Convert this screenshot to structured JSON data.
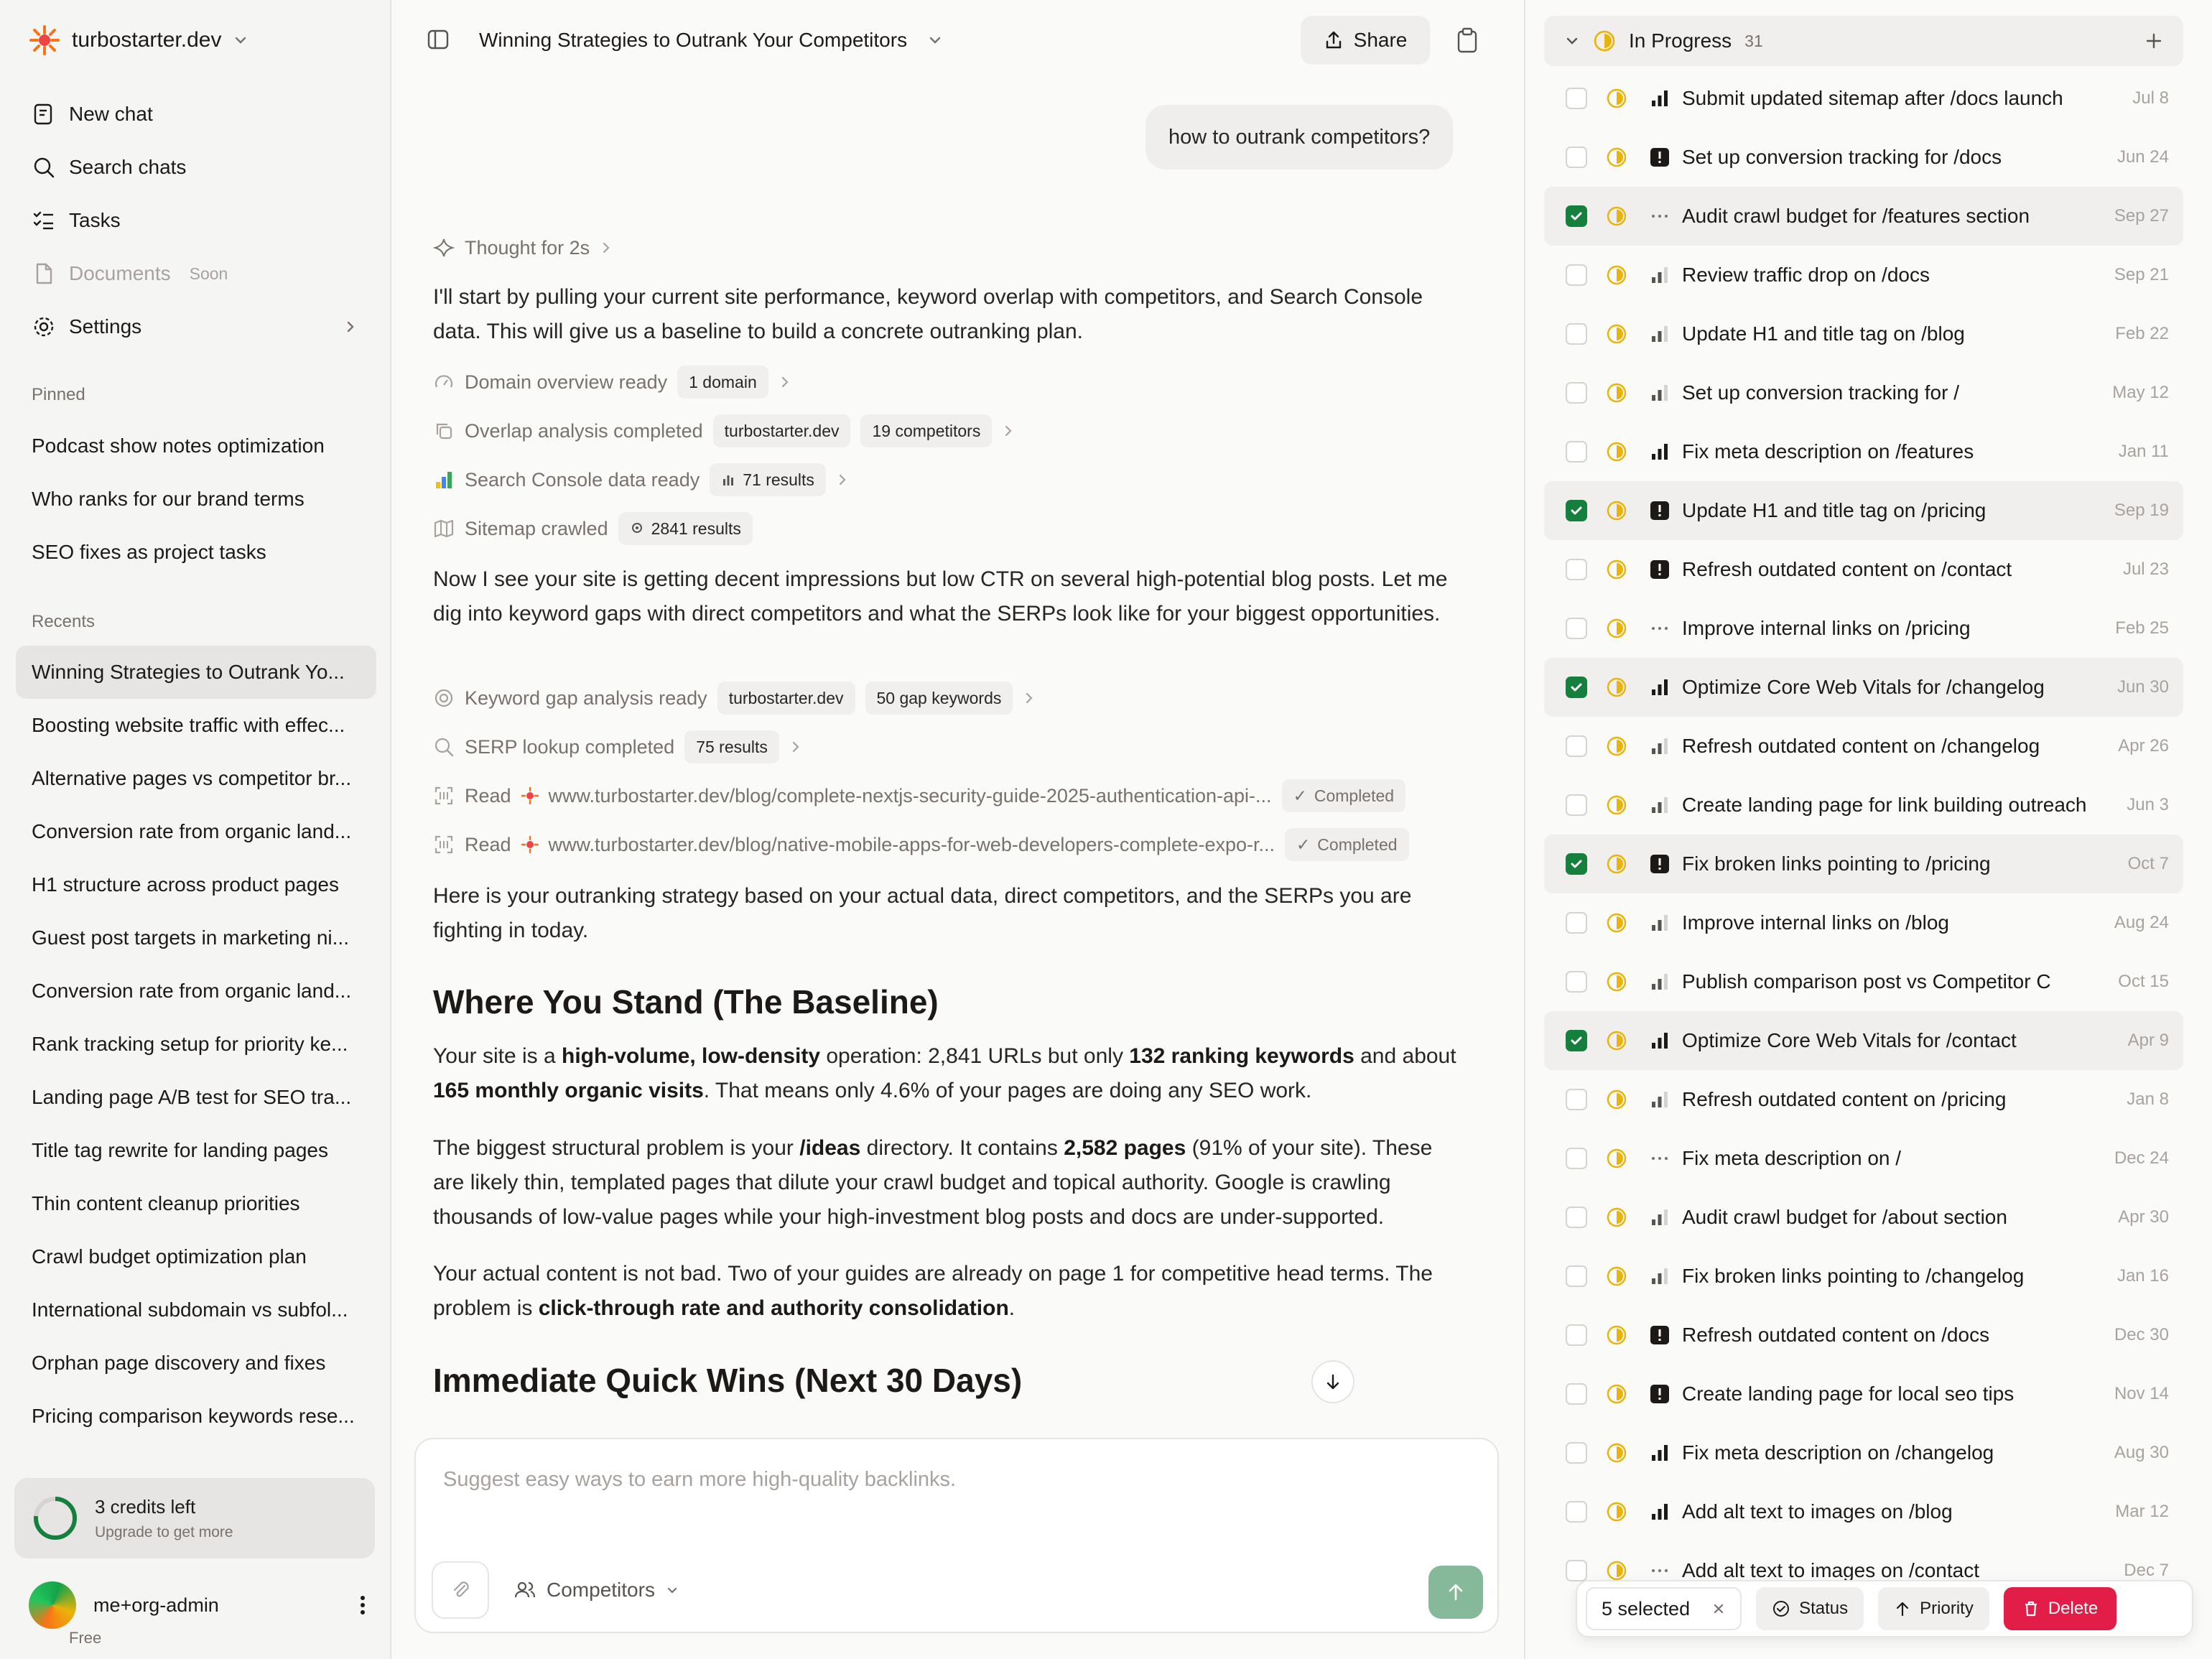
{
  "sidebar": {
    "brand": "turbostarter.dev",
    "nav": [
      {
        "label": "New chat"
      },
      {
        "label": "Search chats"
      },
      {
        "label": "Tasks"
      },
      {
        "label": "Documents",
        "badge": "Soon"
      },
      {
        "label": "Settings"
      }
    ],
    "pinned_title": "Pinned",
    "pinned": [
      "Podcast show notes optimization",
      "Who ranks for our brand terms",
      "SEO fixes as project tasks"
    ],
    "recents_title": "Recents",
    "recents": [
      "Winning Strategies to Outrank Yo...",
      "Boosting website traffic with effec...",
      "Alternative pages vs competitor br...",
      "Conversion rate from organic land...",
      "H1 structure across product pages",
      "Guest post targets in marketing ni...",
      "Conversion rate from organic land...",
      "Rank tracking setup for priority ke...",
      "Landing page A/B test for SEO tra...",
      "Title tag rewrite for landing pages",
      "Thin content cleanup priorities",
      "Crawl budget optimization plan",
      "International subdomain vs subfol...",
      "Orphan page discovery and fixes",
      "Pricing comparison keywords rese..."
    ],
    "credits": {
      "title": "3 credits left",
      "subtitle": "Upgrade to get more"
    },
    "user": {
      "name": "me+org-admin",
      "plan": "Free"
    }
  },
  "chat": {
    "title": "Winning Strategies to Outrank Your Competitors",
    "share_label": "Share",
    "user_message": "how to outrank competitors?",
    "thought": "Thought for 2s",
    "intro": "I'll start by pulling your current site performance, keyword overlap with competitors, and Search Console data. This will give us a baseline to build a concrete outranking plan.",
    "tools1": [
      {
        "label": "Domain overview ready",
        "chips": [
          "1 domain"
        ]
      },
      {
        "label": "Overlap analysis completed",
        "chips": [
          "turbostarter.dev",
          "19 competitors"
        ]
      },
      {
        "label": "Search Console data ready",
        "chips": [
          "71 results"
        ]
      },
      {
        "label": "Sitemap crawled",
        "chips": [
          "2841 results"
        ]
      }
    ],
    "para2": "Now I see your site is getting decent impressions but low CTR on several high-potential blog posts. Let me dig into keyword gaps with direct competitors and what the SERPs look like for your biggest opportunities.",
    "tools2": [
      {
        "label": "Keyword gap analysis ready",
        "chips": [
          "turbostarter.dev",
          "50 gap keywords"
        ]
      },
      {
        "label": "SERP lookup completed",
        "chips": [
          "75 results"
        ]
      }
    ],
    "reads": [
      {
        "verb": "Read",
        "url": "www.turbostarter.dev/blog/complete-nextjs-security-guide-2025-authentication-api-...",
        "status": "Completed"
      },
      {
        "verb": "Read",
        "url": "www.turbostarter.dev/blog/native-mobile-apps-for-web-developers-complete-expo-r...",
        "status": "Completed"
      }
    ],
    "para3": "Here is your outranking strategy based on your actual data, direct competitors, and the SERPs you are fighting in today.",
    "h_baseline": "Where You Stand (The Baseline)",
    "b1": {
      "t1": "Your site is a ",
      "b1": "high-volume, low-density",
      "t2": " operation: 2,841 URLs but only ",
      "b2": "132 ranking keywords",
      "t3": " and about ",
      "b3": "165 monthly organic visits",
      "t4": ". That means only 4.6% of your pages are doing any SEO work."
    },
    "b2": {
      "t1": "The biggest structural problem is your ",
      "b1": "/ideas",
      "t2": " directory. It contains ",
      "b2": "2,582 pages",
      "t3": " (91% of your site). These are likely thin, templated pages that dilute your crawl budget and topical authority. Google is crawling thousands of low-value pages while your high-investment blog posts and docs are under-supported."
    },
    "b3": {
      "t1": "Your actual content is not bad. Two of your guides are already on page 1 for competitive head terms. The problem is ",
      "b1": "click-through rate and authority consolidation",
      "t2": "."
    },
    "h_quick": "Immediate Quick Wins (Next 30 Days)",
    "composer_placeholder": "Suggest easy ways to earn more high-quality backlinks.",
    "competitors_label": "Competitors"
  },
  "panel": {
    "group": "In Progress",
    "count": "31",
    "tasks": [
      {
        "title": "Submit updated sitemap after /docs launch",
        "date": "Jul 8",
        "priority": "high",
        "checked": false
      },
      {
        "title": "Set up conversion tracking for /docs",
        "date": "Jun 24",
        "priority": "urgent",
        "checked": false
      },
      {
        "title": "Audit crawl budget for /features section",
        "date": "Sep 27",
        "priority": "none",
        "checked": true
      },
      {
        "title": "Review traffic drop on /docs",
        "date": "Sep 21",
        "priority": "medium",
        "checked": false
      },
      {
        "title": "Update H1 and title tag on /blog",
        "date": "Feb 22",
        "priority": "medium",
        "checked": false
      },
      {
        "title": "Set up conversion tracking for /",
        "date": "May 12",
        "priority": "medium",
        "checked": false
      },
      {
        "title": "Fix meta description on /features",
        "date": "Jan 11",
        "priority": "high",
        "checked": false
      },
      {
        "title": "Update H1 and title tag on /pricing",
        "date": "Sep 19",
        "priority": "urgent",
        "checked": true
      },
      {
        "title": "Refresh outdated content on /contact",
        "date": "Jul 23",
        "priority": "urgent",
        "checked": false
      },
      {
        "title": "Improve internal links on /pricing",
        "date": "Feb 25",
        "priority": "none",
        "checked": false
      },
      {
        "title": "Optimize Core Web Vitals for /changelog",
        "date": "Jun 30",
        "priority": "high",
        "checked": true
      },
      {
        "title": "Refresh outdated content on /changelog",
        "date": "Apr 26",
        "priority": "medium",
        "checked": false
      },
      {
        "title": "Create landing page for link building outreach",
        "date": "Jun 3",
        "priority": "medium",
        "checked": false
      },
      {
        "title": "Fix broken links pointing to /pricing",
        "date": "Oct 7",
        "priority": "urgent",
        "checked": true
      },
      {
        "title": "Improve internal links on /blog",
        "date": "Aug 24",
        "priority": "medium",
        "checked": false
      },
      {
        "title": "Publish comparison post vs Competitor C",
        "date": "Oct 15",
        "priority": "medium",
        "checked": false
      },
      {
        "title": "Optimize Core Web Vitals for /contact",
        "date": "Apr 9",
        "priority": "high",
        "checked": true
      },
      {
        "title": "Refresh outdated content on /pricing",
        "date": "Jan 8",
        "priority": "medium",
        "checked": false
      },
      {
        "title": "Fix meta description on /",
        "date": "Dec 24",
        "priority": "none",
        "checked": false
      },
      {
        "title": "Audit crawl budget for /about section",
        "date": "Apr 30",
        "priority": "medium",
        "checked": false
      },
      {
        "title": "Fix broken links pointing to /changelog",
        "date": "Jan 16",
        "priority": "medium",
        "checked": false
      },
      {
        "title": "Refresh outdated content on /docs",
        "date": "Dec 30",
        "priority": "urgent",
        "checked": false
      },
      {
        "title": "Create landing page for local seo tips",
        "date": "Nov 14",
        "priority": "urgent",
        "checked": false
      },
      {
        "title": "Fix meta description on /changelog",
        "date": "Aug 30",
        "priority": "high",
        "checked": false
      },
      {
        "title": "Add alt text to images on /blog",
        "date": "Mar 12",
        "priority": "high",
        "checked": false
      },
      {
        "title": "Add alt text to images on /contact",
        "date": "Dec 7",
        "priority": "none",
        "checked": false
      }
    ],
    "bulk": {
      "selected": "5 selected",
      "status": "Status",
      "priority": "Priority",
      "delete": "Delete"
    }
  },
  "colors": {
    "accent_green": "#15803d",
    "progress_yellow": "#eab308",
    "danger": "#e11d48",
    "brand_orange": "#f97316"
  }
}
